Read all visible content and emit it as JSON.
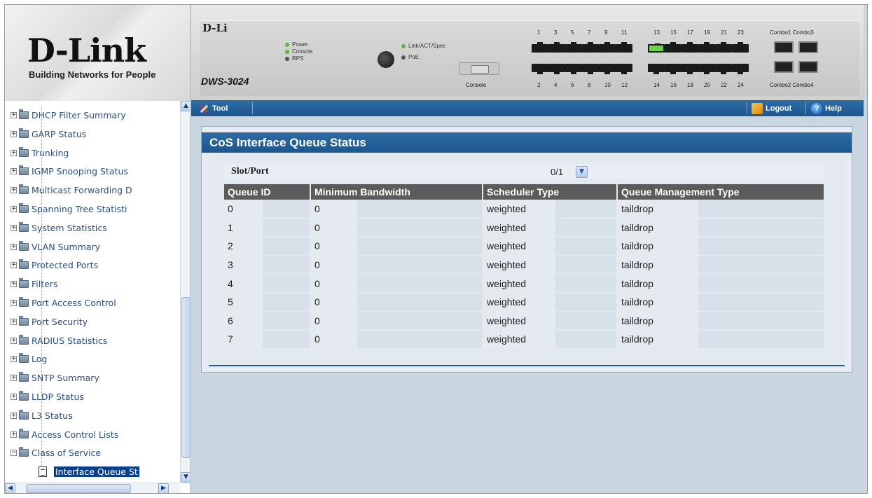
{
  "header": {
    "logo_text": "D-Link",
    "logo_tagline": "Building Networks for People",
    "device_brand": "D-Li",
    "device_model": "DWS-3024",
    "leds": [
      "Power",
      "Console",
      "RPS"
    ],
    "leds2": [
      "Link/ACT/Spec",
      "PoE"
    ],
    "console_label": "Console",
    "top_port_numbers": [
      "1",
      "3",
      "5",
      "7",
      "9",
      "11",
      "13",
      "15",
      "17",
      "19",
      "21",
      "23"
    ],
    "bottom_port_numbers": [
      "2",
      "4",
      "6",
      "8",
      "10",
      "12",
      "14",
      "16",
      "18",
      "20",
      "22",
      "24"
    ],
    "combo_top": "Combo1 Combo3",
    "combo_bottom": "Combo2 Combo4"
  },
  "toolbar": {
    "tool_label": "Tool",
    "logout_label": "Logout",
    "help_label": "Help"
  },
  "sidebar": {
    "items": [
      {
        "label": "DHCP Filter Summary"
      },
      {
        "label": "GARP Status"
      },
      {
        "label": "Trunking"
      },
      {
        "label": "IGMP Snooping Status"
      },
      {
        "label": "Multicast Forwarding D"
      },
      {
        "label": "Spanning Tree Statisti"
      },
      {
        "label": "System Statistics"
      },
      {
        "label": "VLAN Summary"
      },
      {
        "label": "Protected Ports"
      },
      {
        "label": "Filters"
      },
      {
        "label": "Port Access Control"
      },
      {
        "label": "Port Security"
      },
      {
        "label": "RADIUS Statistics"
      },
      {
        "label": "Log"
      },
      {
        "label": "SNTP Summary"
      },
      {
        "label": "LLDP Status"
      },
      {
        "label": "L3 Status"
      },
      {
        "label": "Access Control Lists"
      },
      {
        "label": "Class of Service"
      }
    ],
    "selected_child": "Interface Queue St"
  },
  "panel": {
    "title": "CoS Interface Queue Status",
    "slot_port_label": "Slot/Port",
    "slot_port_value": "0/1"
  },
  "table": {
    "headers": [
      "Queue ID",
      "Minimum Bandwidth",
      "Scheduler Type",
      "Queue Management Type"
    ],
    "rows": [
      [
        "0",
        "0",
        "weighted",
        "taildrop"
      ],
      [
        "1",
        "0",
        "weighted",
        "taildrop"
      ],
      [
        "2",
        "0",
        "weighted",
        "taildrop"
      ],
      [
        "3",
        "0",
        "weighted",
        "taildrop"
      ],
      [
        "4",
        "0",
        "weighted",
        "taildrop"
      ],
      [
        "5",
        "0",
        "weighted",
        "taildrop"
      ],
      [
        "6",
        "0",
        "weighted",
        "taildrop"
      ],
      [
        "7",
        "0",
        "weighted",
        "taildrop"
      ]
    ]
  },
  "icons": {
    "tool": "tool-icon",
    "logout": "logout-icon",
    "help": "help-icon",
    "folder": "folder-icon",
    "document": "document-icon"
  },
  "colors": {
    "accent": "#1d5590",
    "table_header": "#5b5b5b",
    "selected_item": "#0a3f8a"
  }
}
